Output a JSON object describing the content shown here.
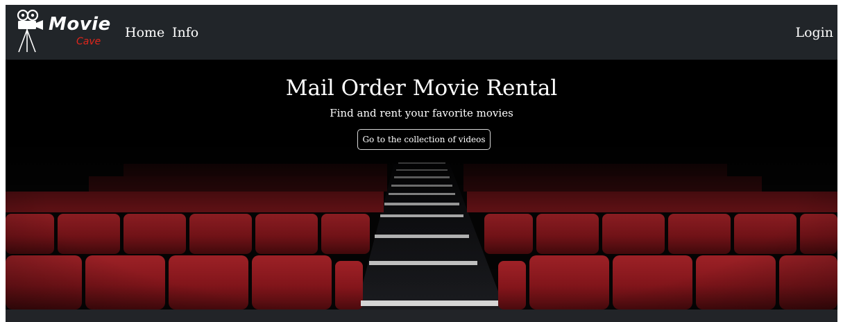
{
  "navbar": {
    "brand": {
      "title": "Movie",
      "subtitle": "Cave",
      "icon": "movie-camera-icon"
    },
    "links": [
      {
        "label": "Home"
      },
      {
        "label": "Info"
      }
    ],
    "login_label": "Login"
  },
  "hero": {
    "title": "Mail Order Movie Rental",
    "subtitle": "Find and rent your favorite movies",
    "button_label": "Go to the collection of videos",
    "background_image": "cinema-seats-image"
  },
  "colors": {
    "navbar_bg": "#212529",
    "brand_accent": "#e1261c",
    "seat_red": "#8e1a1f",
    "text": "#ffffff"
  }
}
